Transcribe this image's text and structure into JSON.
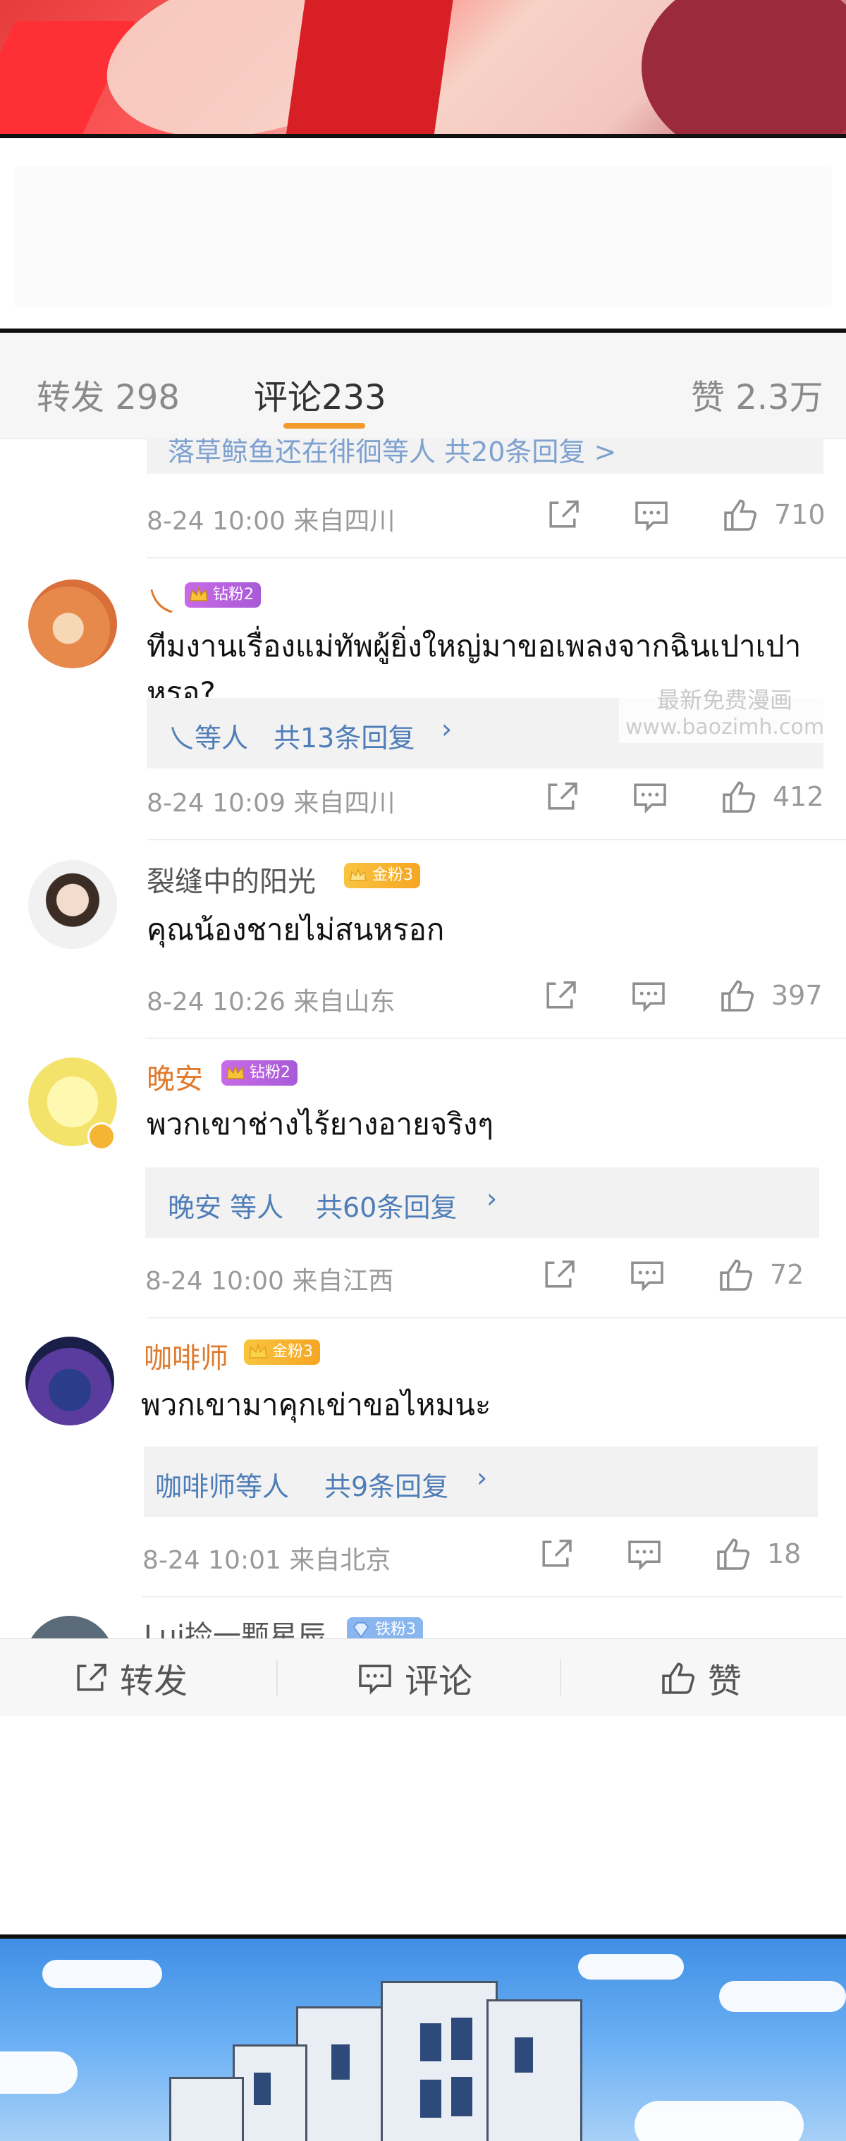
{
  "tabs": {
    "repost": "转发 298",
    "comments": "评论233",
    "likes": "赞 2.3万"
  },
  "partial_reply": "落草鲸鱼还在徘徊等人  共20条回复  >",
  "comments": [
    {
      "meta": "8-24 10:00 来自四川",
      "likes": "710"
    },
    {
      "username": "乀",
      "badge": "钻粉2",
      "text": "ทีมงานเรื่องแม่ทัพผู้ยิ่งใหญ่มาขอเพลงจากฉินเปาเปาหรอ?",
      "reply_who": "乀等人",
      "reply_count": "共13条回复",
      "meta": "8-24 10:09 来自四川",
      "likes": "412"
    },
    {
      "username": "裂缝中的阳光",
      "badge": "金粉3",
      "text": "คุณน้องชายไม่สนหรอก",
      "meta": "8-24 10:26 来自山东",
      "likes": "397"
    },
    {
      "username": "晚安",
      "badge": "钻粉2",
      "text": "พวกเขาช่างไร้ยางอายจริงๆ",
      "reply_who": "晚安 等人",
      "reply_count": "共60条回复",
      "meta": "8-24 10:00 来自江西",
      "likes": "72"
    },
    {
      "username": "咖啡师",
      "badge": "金粉3",
      "text": "พวกเขามาคุกเข่าขอไหมนะ",
      "reply_who": "咖啡师等人",
      "reply_count": "共9条回复",
      "meta": "8-24 10:01 来自北京",
      "likes": "18"
    },
    {
      "username": "Lui捡一颗星辰",
      "badge": "铁粉3"
    }
  ],
  "watermark": {
    "line1": "最新免费漫画",
    "line2": "www.baozimh.com"
  },
  "bottom_bar": {
    "repost": "转发",
    "comment": "评论",
    "like": "赞"
  },
  "colors": {
    "accent": "#f39a2b",
    "link": "#4f7db8",
    "orange_name": "#e07a2e"
  }
}
